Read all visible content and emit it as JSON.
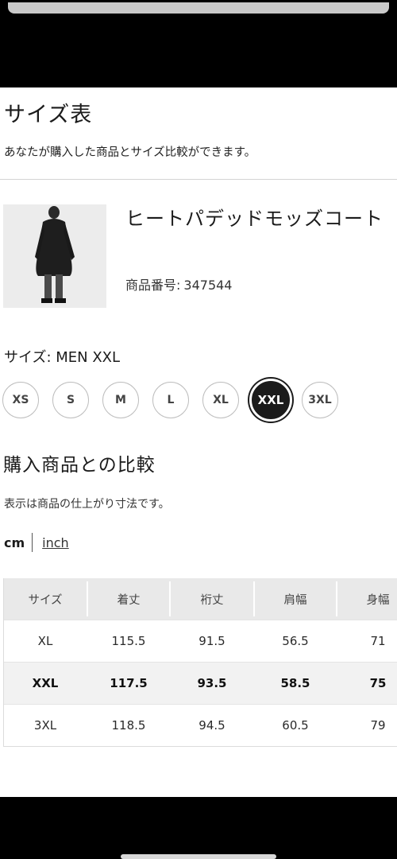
{
  "header": {
    "title": "サイズ表",
    "subtitle": "あなたが購入した商品とサイズ比較ができます。"
  },
  "product": {
    "name": "ヒートパデッドモッズコート",
    "number_label": "商品番号:",
    "number": "347544"
  },
  "size_selector": {
    "label": "サイズ: MEN XXL",
    "options": [
      "XS",
      "S",
      "M",
      "L",
      "XL",
      "XXL",
      "3XL"
    ],
    "selected": "XXL"
  },
  "comparison": {
    "title": "購入商品との比較",
    "note": "表示は商品の仕上がり寸法です。",
    "units": {
      "cm": "cm",
      "inch": "inch",
      "active": "cm"
    }
  },
  "size_table": {
    "headers": [
      "サイズ",
      "着丈",
      "裄丈",
      "肩幅",
      "身幅"
    ],
    "rows": [
      [
        "XL",
        "115.5",
        "91.5",
        "56.5",
        "71"
      ],
      [
        "XXL",
        "117.5",
        "93.5",
        "58.5",
        "75"
      ],
      [
        "3XL",
        "118.5",
        "94.5",
        "60.5",
        "79"
      ]
    ],
    "highlighted_row": "XXL"
  },
  "colors": {
    "selected_chip": "#1b1b1b",
    "header_row_bg": "#e9e9e9",
    "highlight_row_bg": "#f2f2f2"
  }
}
